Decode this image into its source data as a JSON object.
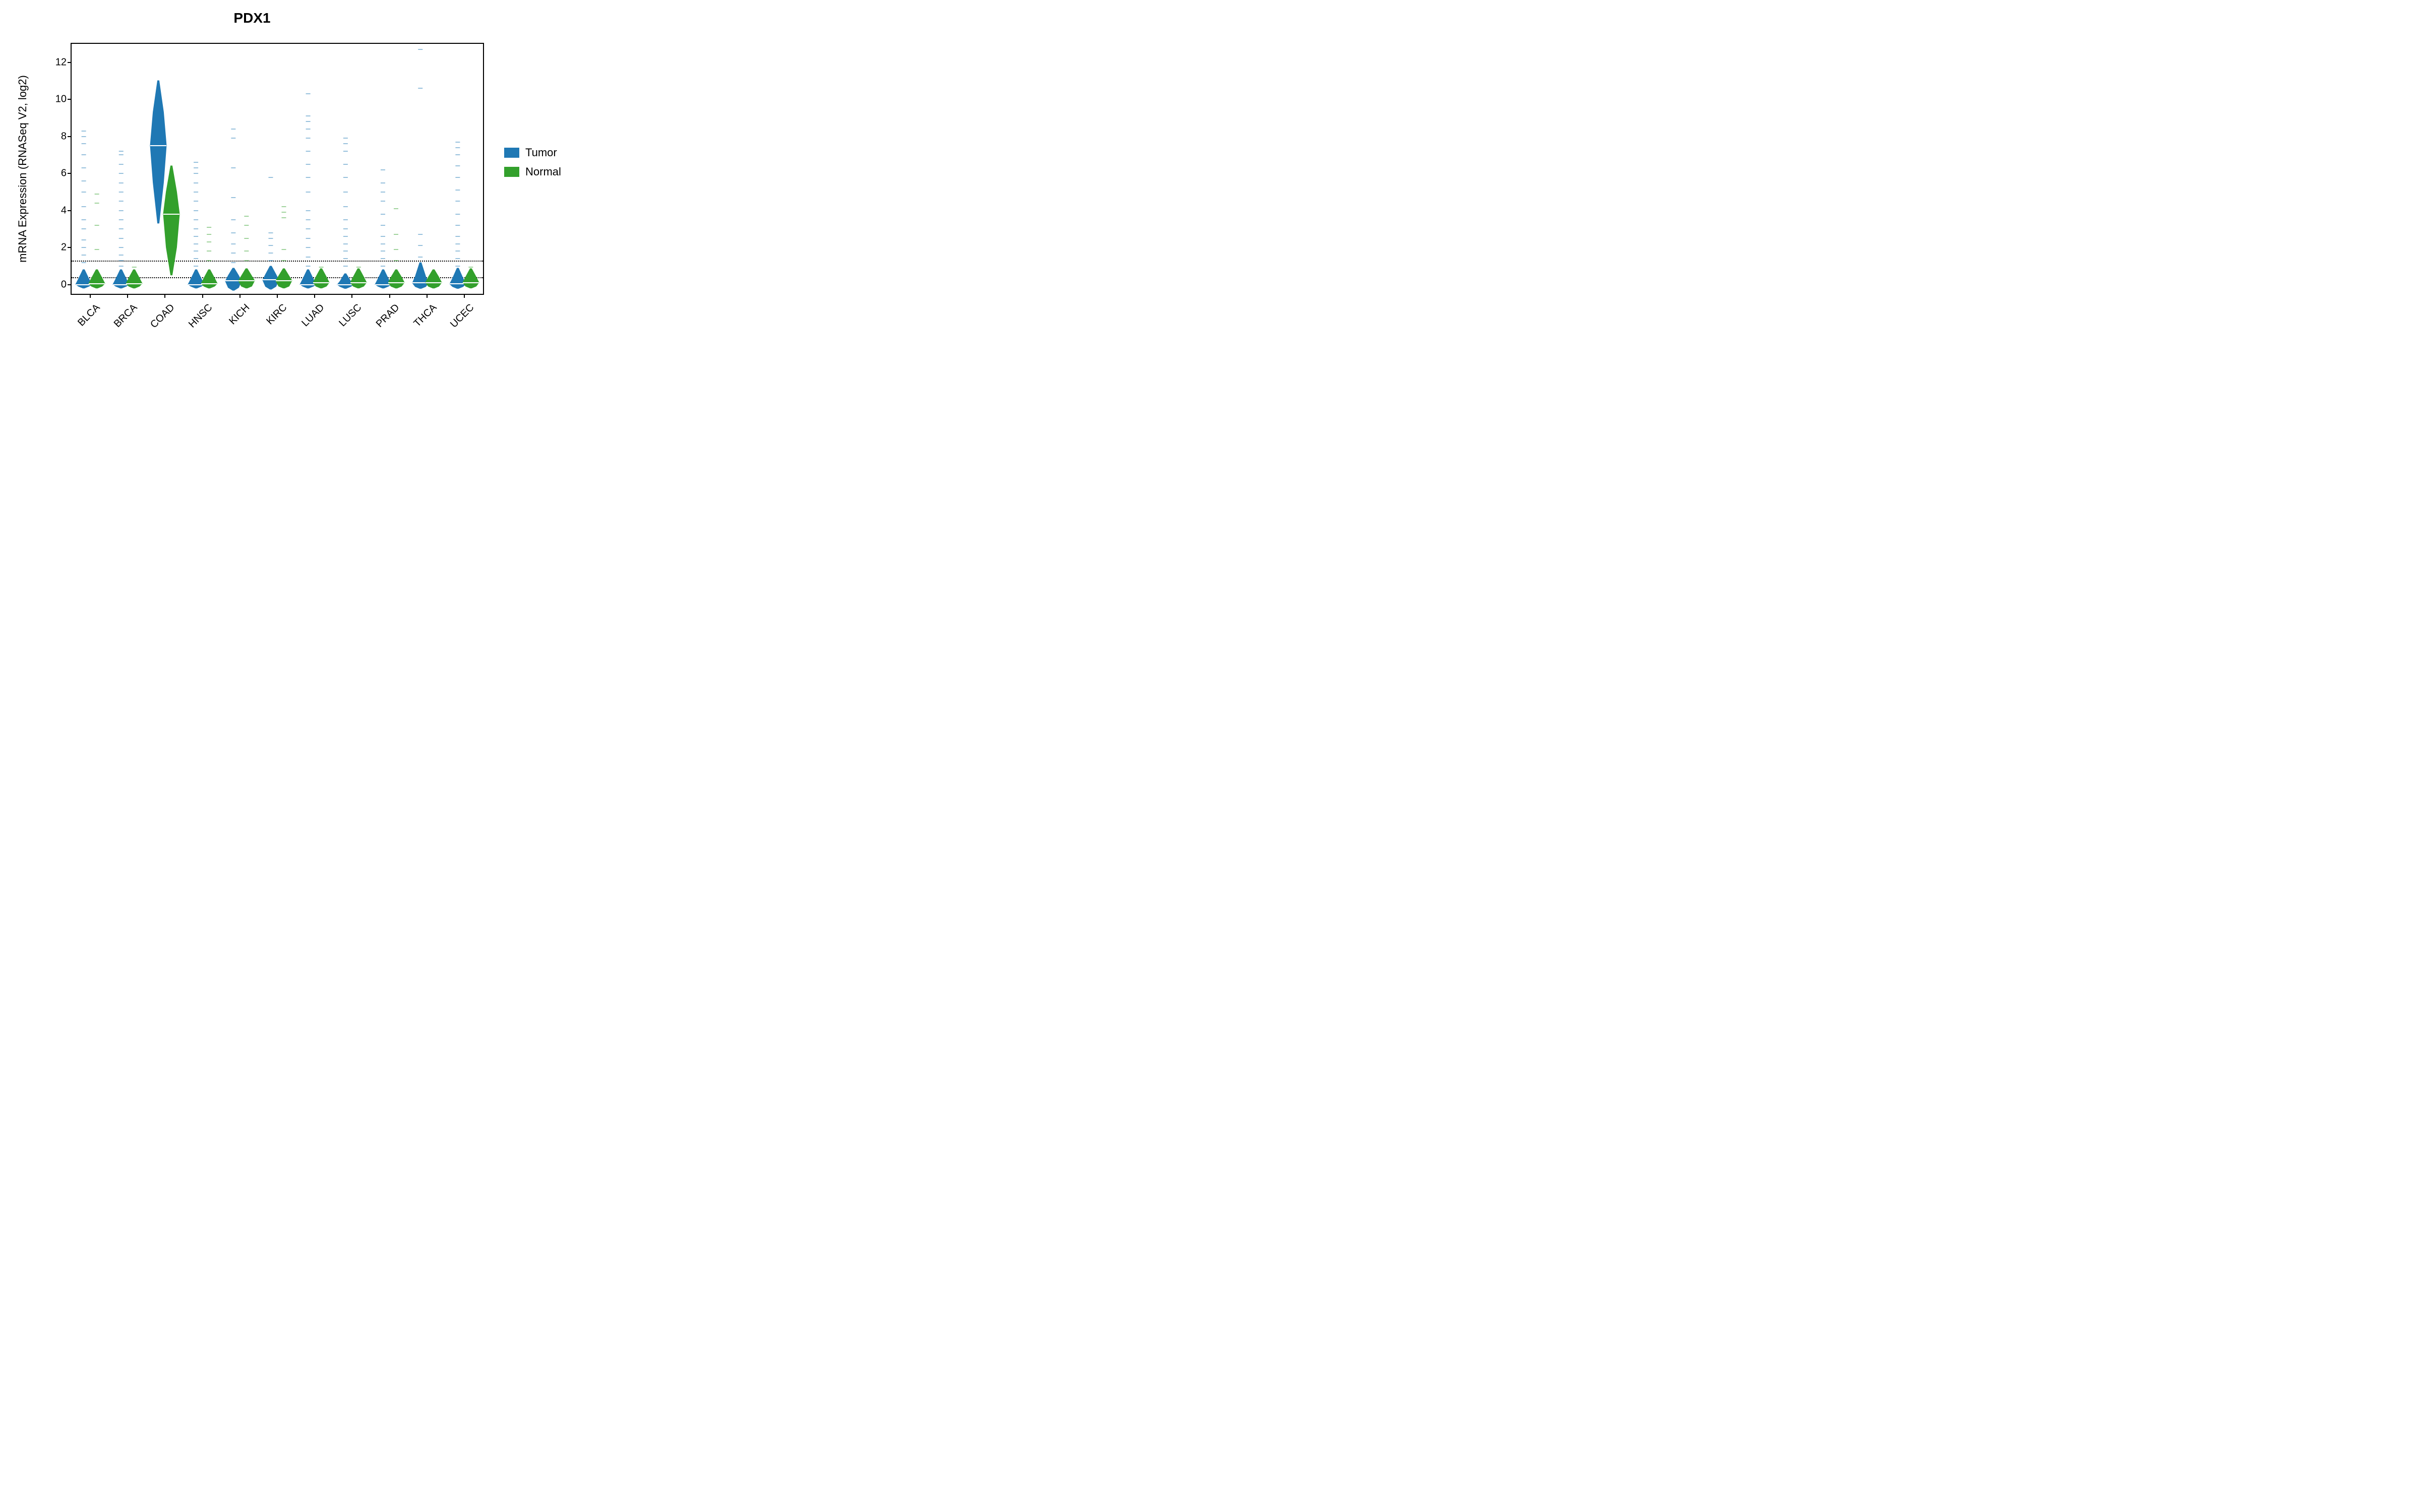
{
  "title": "PDX1",
  "y_axis_title": "mRNA Expression (RNASeq V2, log2)",
  "legend": [
    {
      "label": "Tumor",
      "color": "#1f78b4"
    },
    {
      "label": "Normal",
      "color": "#33a02c"
    }
  ],
  "colors": {
    "tumor": "#1f78b4",
    "normal": "#33a02c"
  },
  "chart_data": {
    "type": "beanplot",
    "title": "PDX1",
    "ylabel": "mRNA Expression (RNASeq V2, log2)",
    "xlabel": "",
    "y_ticks": [
      0,
      2,
      4,
      6,
      8,
      10,
      12
    ],
    "ylim": [
      -0.5,
      13
    ],
    "reference_lines": [
      0.4,
      1.3
    ],
    "categories": [
      "BLCA",
      "BRCA",
      "COAD",
      "HNSC",
      "KICH",
      "KIRC",
      "LUAD",
      "LUSC",
      "PRAD",
      "THCA",
      "UCEC"
    ],
    "series": [
      {
        "name": "Tumor",
        "color": "#1f78b4",
        "median": [
          0.0,
          0.0,
          7.5,
          0.0,
          0.2,
          0.25,
          0.0,
          0.0,
          0.0,
          0.1,
          0.05
        ],
        "q1": [
          -0.1,
          -0.1,
          5.5,
          -0.1,
          -0.15,
          -0.1,
          -0.1,
          -0.1,
          -0.1,
          -0.1,
          -0.1
        ],
        "q3": [
          0.3,
          0.3,
          9.3,
          0.3,
          0.5,
          0.55,
          0.3,
          0.2,
          0.3,
          0.45,
          0.35
        ],
        "whisk_lo": [
          -0.2,
          -0.2,
          3.3,
          -0.2,
          -0.3,
          -0.25,
          -0.2,
          -0.2,
          -0.2,
          -0.2,
          -0.2
        ],
        "whisk_hi": [
          0.8,
          0.8,
          11.0,
          0.8,
          0.9,
          1.0,
          0.8,
          0.6,
          0.8,
          1.2,
          0.9
        ],
        "outliers": [
          [
            1.2,
            1.6,
            2.0,
            2.4,
            3.0,
            3.5,
            4.2,
            5.0,
            5.6,
            6.3,
            7.0,
            7.6,
            8.0,
            8.3
          ],
          [
            1.0,
            1.3,
            1.6,
            2.0,
            2.5,
            3.0,
            3.5,
            4.0,
            4.5,
            5.0,
            5.5,
            6.0,
            6.5,
            7.0,
            7.2
          ],
          [],
          [
            1.0,
            1.4,
            1.8,
            2.2,
            2.6,
            3.0,
            3.5,
            4.0,
            4.5,
            5.0,
            5.5,
            6.0,
            6.3,
            6.6
          ],
          [
            1.2,
            1.7,
            2.2,
            2.8,
            3.5,
            4.7,
            6.3,
            7.9,
            8.4
          ],
          [
            1.3,
            1.7,
            2.1,
            2.5,
            2.8,
            5.8
          ],
          [
            1.0,
            1.5,
            2.0,
            2.5,
            3.0,
            3.5,
            4.0,
            5.0,
            5.8,
            6.5,
            7.2,
            7.9,
            8.4,
            8.8,
            9.1,
            10.3
          ],
          [
            1.0,
            1.4,
            1.8,
            2.2,
            2.6,
            3.0,
            3.5,
            4.2,
            5.0,
            5.8,
            6.5,
            7.2,
            7.6,
            7.9
          ],
          [
            1.0,
            1.4,
            1.8,
            2.2,
            2.6,
            3.2,
            3.8,
            4.5,
            5.0,
            5.5,
            6.2
          ],
          [
            1.5,
            2.1,
            2.7,
            10.6,
            12.7
          ],
          [
            1.0,
            1.4,
            1.8,
            2.2,
            2.6,
            3.2,
            3.8,
            4.5,
            5.1,
            5.8,
            6.4,
            7.0,
            7.4,
            7.7
          ]
        ]
      },
      {
        "name": "Normal",
        "color": "#33a02c",
        "median": [
          0.05,
          0.05,
          3.8,
          0.05,
          0.2,
          0.2,
          0.1,
          0.1,
          0.1,
          0.1,
          0.1
        ],
        "q1": [
          -0.1,
          -0.1,
          2.0,
          -0.1,
          -0.1,
          -0.1,
          -0.1,
          -0.1,
          -0.1,
          -0.1,
          -0.1
        ],
        "q3": [
          0.35,
          0.35,
          5.0,
          0.35,
          0.45,
          0.45,
          0.4,
          0.4,
          0.4,
          0.4,
          0.4
        ],
        "whisk_lo": [
          -0.2,
          -0.2,
          0.5,
          -0.2,
          -0.2,
          -0.2,
          -0.2,
          -0.2,
          -0.2,
          -0.2,
          -0.2
        ],
        "whisk_hi": [
          0.8,
          0.8,
          6.4,
          0.8,
          0.85,
          0.85,
          0.85,
          0.85,
          0.8,
          0.8,
          0.85
        ],
        "outliers": [
          [
            1.9,
            3.2,
            4.4,
            4.9
          ],
          [
            0.95
          ],
          [],
          [
            1.3,
            1.8,
            2.3,
            2.7,
            3.1
          ],
          [
            1.3,
            1.8,
            2.5,
            3.2,
            3.7
          ],
          [
            1.3,
            1.9,
            3.6,
            3.9,
            4.2
          ],
          [
            0.95
          ],
          [
            0.95
          ],
          [
            1.3,
            1.9,
            2.7,
            4.1
          ],
          [],
          [
            0.95
          ]
        ]
      }
    ]
  }
}
